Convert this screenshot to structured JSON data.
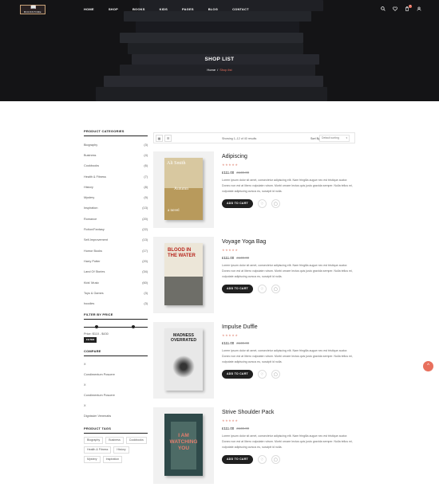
{
  "header": {
    "logo_text": "BOOKSTORE",
    "nav": [
      "HOME",
      "SHOP",
      "BOOKS",
      "KIDS",
      "PAGES",
      "BLOG",
      "CONTACT"
    ],
    "cart_count": "0",
    "icons": [
      "search-icon",
      "heart-icon",
      "cart-icon",
      "user-icon"
    ]
  },
  "hero": {
    "title": "SHOP LIST",
    "breadcrumb": {
      "home": "Home",
      "separator": "/",
      "current": "Shop list"
    }
  },
  "sidebar": {
    "categories_title": "PRODUCT CATEGORIES",
    "categories": [
      {
        "name": "Biography",
        "count": "(3)"
      },
      {
        "name": "Business",
        "count": "(4)"
      },
      {
        "name": "Cookbooks",
        "count": "(6)"
      },
      {
        "name": "Health & Fitness",
        "count": "(7)"
      },
      {
        "name": "History",
        "count": "(8)"
      },
      {
        "name": "Mystery",
        "count": "(9)"
      },
      {
        "name": "Inspiration",
        "count": "(13)"
      },
      {
        "name": "Romance",
        "count": "(20)"
      },
      {
        "name": "Fiction/Fantasy",
        "count": "(22)"
      },
      {
        "name": "Self-Improvement",
        "count": "(13)"
      },
      {
        "name": "Humor Books",
        "count": "(17)"
      },
      {
        "name": "Harry Potter",
        "count": "(20)"
      },
      {
        "name": "Land Of Stories",
        "count": "(34)"
      },
      {
        "name": "Kids' Music",
        "count": "(60)"
      },
      {
        "name": "Toys & Games",
        "count": "(3)"
      },
      {
        "name": "hoodies",
        "count": "(3)"
      }
    ],
    "filter_title": "FILTER BY PRICE",
    "price_label": "Price: $110 - $430",
    "filter_button": "FILTER",
    "compare_title": "COMPARE",
    "compare_items": [
      "X",
      "Condimentum Posuere",
      "X",
      "Condimentum Posuere",
      "X",
      "Dignissim Venenatis"
    ],
    "tags_title": "PRODUCT TAGS",
    "tags": [
      "Biography",
      "Business",
      "Cookbooks",
      "Health & Fitness",
      "History",
      "Mystery",
      "Inspiration"
    ]
  },
  "toolbar": {
    "grid_icon": "▦",
    "list_icon": "☰",
    "showing": "Showing 1–12 of 40 results",
    "sort_label": "Sort By",
    "sort_value": "Default sorting",
    "sort_arrow": "▾"
  },
  "product_desc": "Lorem ipsum dolor sit amet, consectetur adipiscing elit. Nam fringilla augue nec est tristique auctor. Donec non est at libero vulputate rutrum. Morbi ornare lectus quis justo gravida semper. Nulla tellus mi, vulputate adipiscing cursus eu, suscipit id nulla.",
  "products": [
    {
      "name": "Adipiscing",
      "price": "£111.00",
      "old_price": "£130.00",
      "stars": "★★★★★",
      "add_to_cart": "ADD TO CART",
      "cover_author": "Ali Smith",
      "cover_title": "Autumn",
      "cover_sub": "a novel"
    },
    {
      "name": "Voyage Yoga Bag",
      "price": "£111.00",
      "old_price": "£130.00",
      "stars": "★★★★★",
      "add_to_cart": "ADD TO CART",
      "cover_title": "BLOOD IN THE WATER"
    },
    {
      "name": "Impulse Duffle",
      "price": "£111.00",
      "old_price": "£130.00",
      "stars": "★★★★★",
      "add_to_cart": "ADD TO CART",
      "cover_title": "MADNESS OVERRATED"
    },
    {
      "name": "Strive Shoulder Pack",
      "price": "£111.00",
      "old_price": "£130.00",
      "stars": "★★★★★",
      "add_to_cart": "ADD TO CART",
      "cover_title": "I AM WATCHING YOU"
    }
  ],
  "glyphs": {
    "wishlist": "♡",
    "quickview": "◯",
    "to_top": "^"
  },
  "colors": {
    "accent": "#e8705d",
    "dark": "#1f1f1f",
    "hero_bg": "#1b1b1d"
  }
}
